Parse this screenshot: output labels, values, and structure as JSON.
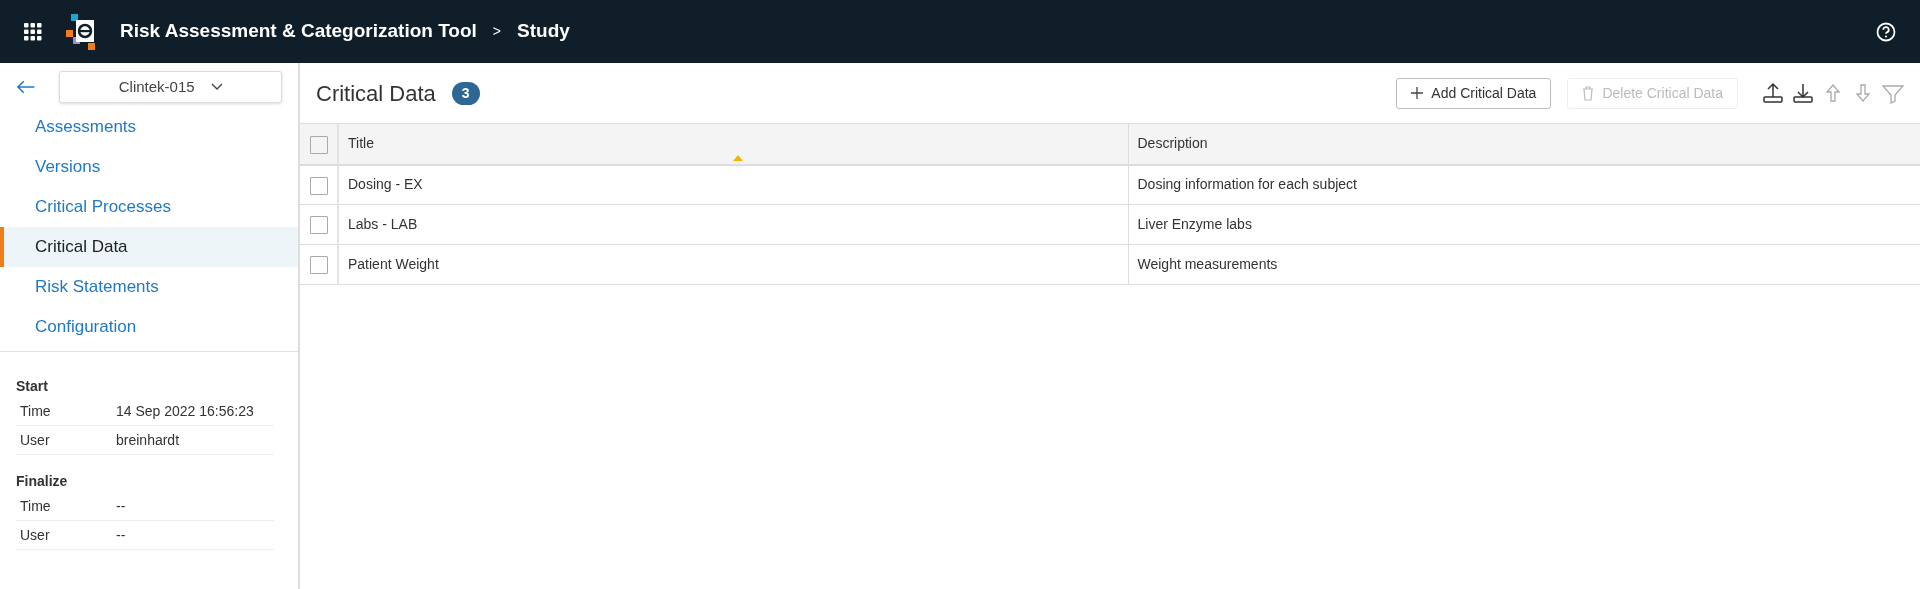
{
  "header": {
    "app_title": "Risk Assessment & Categorization Tool",
    "breadcrumb_separator": ">",
    "page": "Study"
  },
  "sidebar": {
    "study_selector": {
      "value": "Clintek-015"
    },
    "items": [
      {
        "label": "Assessments",
        "selected": false
      },
      {
        "label": "Versions",
        "selected": false
      },
      {
        "label": "Critical Processes",
        "selected": false
      },
      {
        "label": "Critical Data",
        "selected": true
      },
      {
        "label": "Risk Statements",
        "selected": false
      },
      {
        "label": "Configuration",
        "selected": false
      }
    ],
    "details": [
      {
        "heading": "Start",
        "rows": [
          {
            "label": "Time",
            "value": "14 Sep 2022 16:56:23"
          },
          {
            "label": "User",
            "value": "breinhardt"
          }
        ]
      },
      {
        "heading": "Finalize",
        "rows": [
          {
            "label": "Time",
            "value": "--"
          },
          {
            "label": "User",
            "value": "--"
          }
        ]
      }
    ]
  },
  "main": {
    "title": "Critical Data",
    "count": "3",
    "buttons": [
      {
        "label": "Add Critical Data",
        "kind": "add",
        "disabled": false
      },
      {
        "label": "Delete Critical Data",
        "kind": "delete",
        "disabled": true
      }
    ],
    "tools": [
      {
        "kind": "upload",
        "disabled": false
      },
      {
        "kind": "download",
        "disabled": false
      },
      {
        "kind": "up",
        "disabled": true
      },
      {
        "kind": "down",
        "disabled": true
      },
      {
        "kind": "filter",
        "disabled": true
      }
    ],
    "table": {
      "select_all": {
        "checked": false
      },
      "columns": [
        {
          "label": "Title",
          "sorted": true
        },
        {
          "label": "Description",
          "sorted": false
        }
      ],
      "rows": [
        {
          "checked": false,
          "cells": [
            "Dosing - EX",
            "Dosing information for each subject"
          ]
        },
        {
          "checked": false,
          "cells": [
            "Labs - LAB",
            "Liver Enzyme labs"
          ]
        },
        {
          "checked": false,
          "cells": [
            "Patient Weight",
            "Weight measurements"
          ]
        }
      ]
    }
  }
}
